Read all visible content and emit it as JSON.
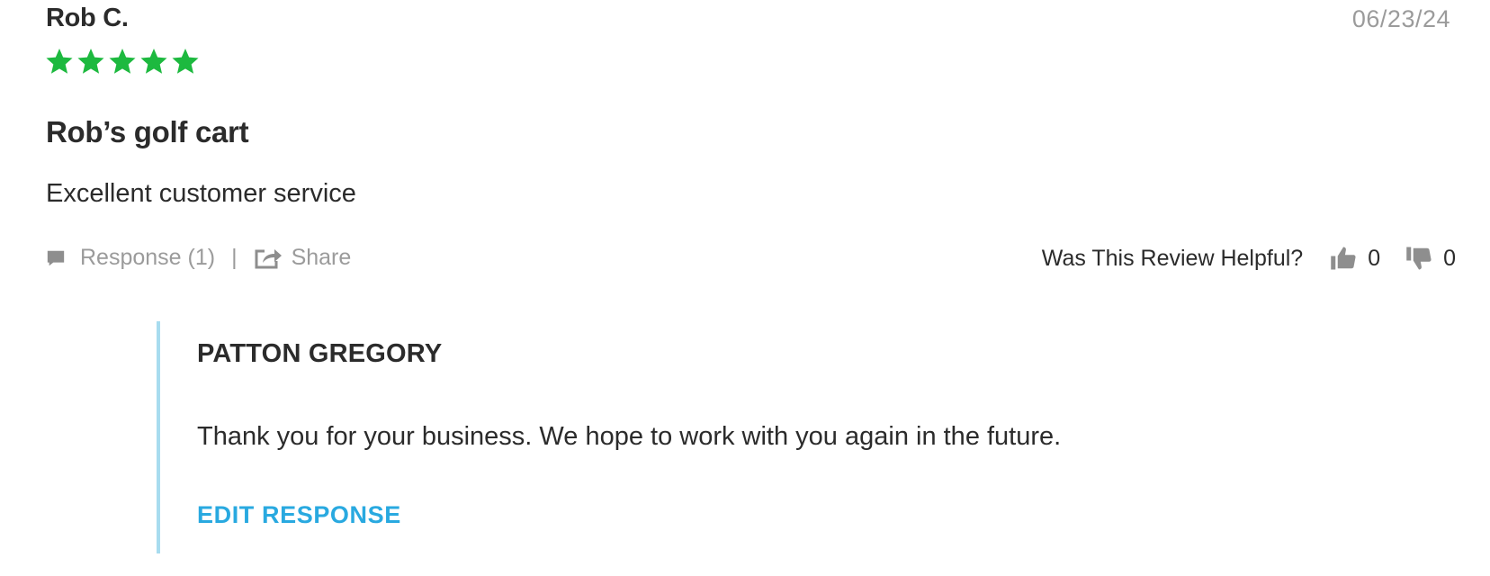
{
  "review": {
    "reviewer_name": "Rob C.",
    "date": "06/23/24",
    "rating": 5,
    "rating_max": 5,
    "title": "Rob’s golf cart",
    "body": "Excellent customer service"
  },
  "actions": {
    "response_label": "Response (1)",
    "separator": "|",
    "share_label": "Share",
    "helpful_label": "Was This Review Helpful?",
    "thumbs_up_count": "0",
    "thumbs_down_count": "0"
  },
  "response": {
    "responder_name": "PATTON GREGORY",
    "text": "Thank you for your business. We hope to work with you again in the future.",
    "edit_label": "EDIT RESPONSE"
  },
  "colors": {
    "star": "#1db93f",
    "muted_text": "#9b9b9b",
    "accent_link": "#29a9e0",
    "response_border": "#a8dcef",
    "icon_gray": "#8e8e8e"
  },
  "icons": {
    "star": "star-icon",
    "response": "comment-icon",
    "share": "share-icon",
    "thumbs_up": "thumbs-up-icon",
    "thumbs_down": "thumbs-down-icon"
  }
}
